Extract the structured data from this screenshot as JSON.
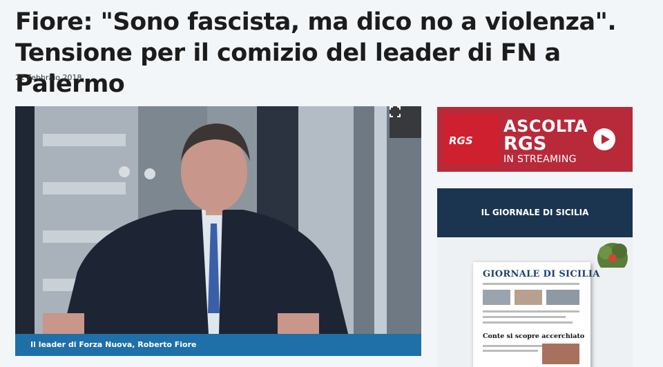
{
  "article": {
    "title": "Fiore: \"Sono fascista, ma dico no a violenza\". Tensione per il comizio del leader di FN a Palermo",
    "date": "22 Febbraio 2018",
    "photo_caption": "Il leader di Forza Nuova, Roberto Fiore",
    "fullscreen_icon": "expand-icon"
  },
  "sidebar": {
    "radio_banner": {
      "logo_text": "RGS",
      "line1": "ASCOLTA",
      "line2": "RGS",
      "line3": "IN STREAMING",
      "play_icon": "play-icon",
      "color": "#b82a3a"
    },
    "newspaper": {
      "header": "IL GIORNALE DI SICILIA",
      "masthead": "GIORNALE DI SICILIA",
      "headline": "Conte si scopre accerchiato",
      "color": "#1b3450"
    }
  },
  "colors": {
    "caption_bg": "#1f6fa8",
    "page_bg": "#f3f6f9"
  }
}
